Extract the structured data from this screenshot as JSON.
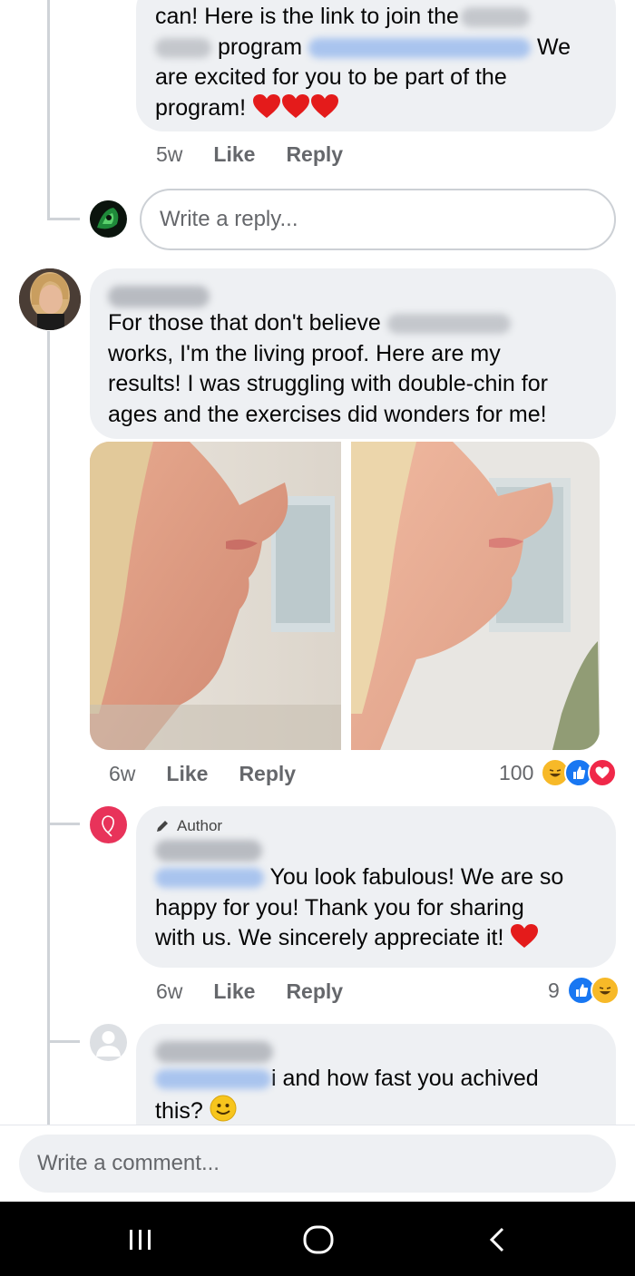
{
  "comment1_reply": {
    "lines": [
      "can! Here is the link to join the",
      "program",
      "We",
      "are excited for you to be part of the",
      "program!"
    ],
    "time": "5w",
    "like": "Like",
    "reply": "Reply"
  },
  "reply_input": {
    "placeholder": "Write a reply..."
  },
  "comment2": {
    "lines": [
      "For those that don't believe",
      "works, I'm the living proof. Here are my",
      "results! I was struggling with double-chin for",
      "ages and the exercises did wonders for me!"
    ],
    "time": "6w",
    "like": "Like",
    "reply": "Reply",
    "reaction_count": "100"
  },
  "author_reply": {
    "badge": "Author",
    "lines": [
      "You look fabulous! We are so",
      "happy for you! Thank you for sharing",
      "with us. We sincerely appreciate it!"
    ],
    "time": "6w",
    "like": "Like",
    "reply": "Reply",
    "reaction_count": "9"
  },
  "comment3": {
    "lines": [
      "i and how fast you achived",
      "this?"
    ]
  },
  "comment_input": {
    "placeholder": "Write a comment..."
  },
  "colors": {
    "like_blue": "#1877f2",
    "heart_red": "#f02849",
    "haha_yellow": "#f7b928",
    "author_pink": "#e8335a"
  }
}
